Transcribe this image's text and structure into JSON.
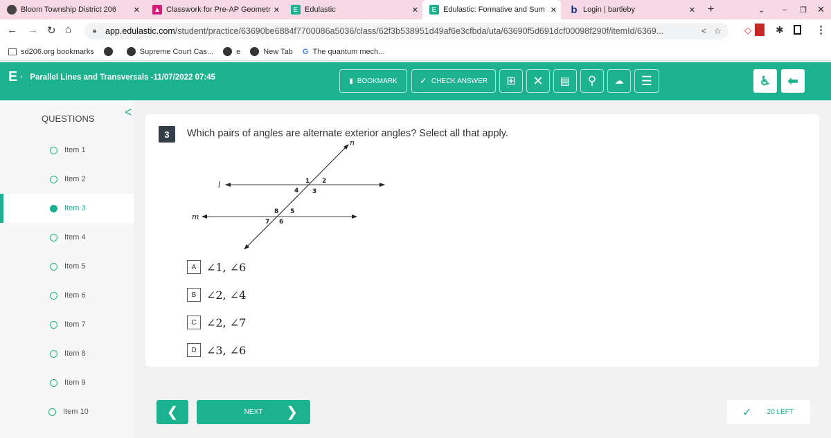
{
  "browser": {
    "tabs": [
      {
        "label": "Bloom Township District 206",
        "icon": "globe-icon"
      },
      {
        "label": "Classwork for Pre-AP Geometr",
        "icon": "classroom-icon"
      },
      {
        "label": "Edulastic",
        "icon": "edulastic-icon"
      },
      {
        "label": "Edulastic: Formative and Sum",
        "icon": "edulastic-icon",
        "active": true
      },
      {
        "label": "Login | bartleby",
        "icon": "bartleby-icon"
      }
    ],
    "url_host": "app.edulastic.com",
    "url_path": "/student/practice/63690be6884f7700086a5036/class/62f3b538951d49af6e3cfbda/uta/63690f5d691dcf00098f290f/itemId/6369...",
    "bookmarks": [
      "sd206.org bookmarks",
      "",
      "Supreme Court Cas...",
      "e",
      "New Tab",
      "The quantum mech..."
    ]
  },
  "header": {
    "title": "Parallel Lines and Transversals -11/07/2022 07:45",
    "bookmark": "BOOKMARK",
    "check_answer": "CHECK ANSWER",
    "accent": "#1db28f"
  },
  "sidebar": {
    "heading": "QUESTIONS",
    "items": [
      "Item 1",
      "Item 2",
      "Item 3",
      "Item 4",
      "Item 5",
      "Item 6",
      "Item 7",
      "Item 8",
      "Item 9",
      "Item 10"
    ],
    "current": 2
  },
  "question": {
    "number": "3",
    "text": "Which pairs of angles are alternate exterior angles? Select all that apply.",
    "diagram": {
      "lines": [
        "l",
        "m",
        "n"
      ],
      "angles": [
        "1",
        "2",
        "3",
        "4",
        "5",
        "6",
        "7",
        "8"
      ]
    },
    "options": [
      {
        "letter": "A",
        "value": "∠1, ∠6"
      },
      {
        "letter": "B",
        "value": "∠2, ∠4"
      },
      {
        "letter": "C",
        "value": "∠2, ∠7"
      },
      {
        "letter": "D",
        "value": "∠3, ∠6"
      }
    ]
  },
  "footer": {
    "next": "NEXT",
    "left": "20 LEFT"
  }
}
